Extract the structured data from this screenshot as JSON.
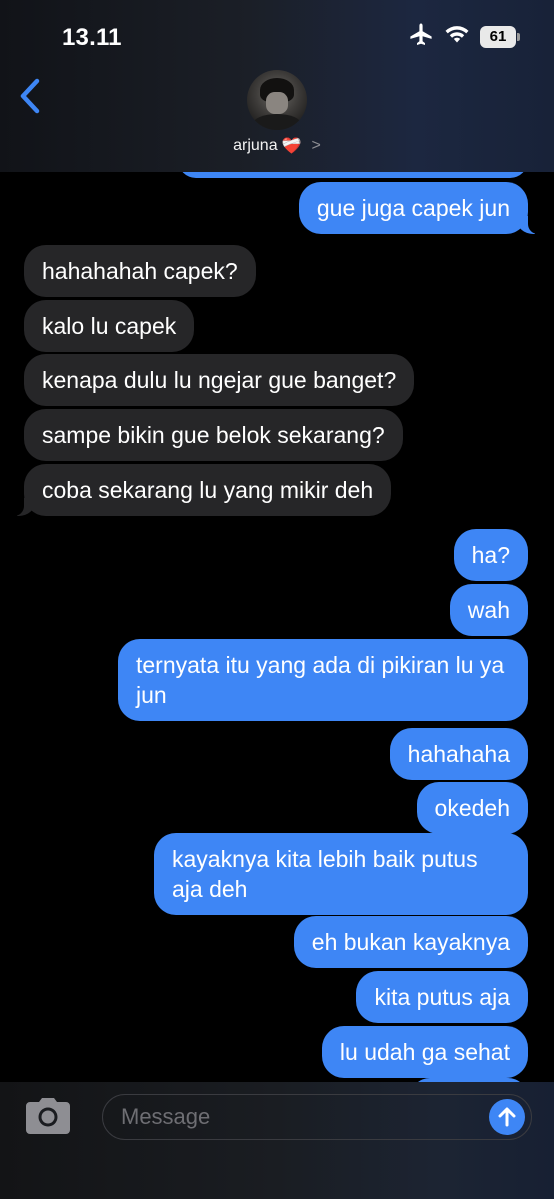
{
  "status_bar": {
    "time": "13.11",
    "battery": "61",
    "icons": [
      "airplane-icon",
      "wifi-icon",
      "battery-icon"
    ]
  },
  "header": {
    "contact_name": "arjuna",
    "contact_emoji": "❤️‍🩹",
    "chevron": ">"
  },
  "messages": [
    {
      "side": "sent",
      "text": "",
      "partial": true
    },
    {
      "side": "sent",
      "text": "gue juga capek jun"
    },
    {
      "side": "received",
      "text": "hahahahah capek?"
    },
    {
      "side": "received",
      "text": "kalo lu capek"
    },
    {
      "side": "received",
      "text": "kenapa dulu lu ngejar gue banget?"
    },
    {
      "side": "received",
      "text": "sampe bikin gue belok sekarang?"
    },
    {
      "side": "received",
      "text": "coba sekarang lu yang mikir deh"
    },
    {
      "side": "sent",
      "text": "ha?"
    },
    {
      "side": "sent",
      "text": "wah"
    },
    {
      "side": "sent",
      "text": "ternyata itu yang ada di pikiran lu ya jun"
    },
    {
      "side": "sent",
      "text": "hahahaha"
    },
    {
      "side": "sent",
      "text": "okedeh"
    },
    {
      "side": "sent",
      "text": "kayaknya kita lebih baik putus aja deh"
    },
    {
      "side": "sent",
      "text": "eh bukan kayaknya"
    },
    {
      "side": "sent",
      "text": "kita putus aja"
    },
    {
      "side": "sent",
      "text": "lu udah ga sehat"
    },
    {
      "side": "sent",
      "text": "",
      "partial": true
    }
  ],
  "composer": {
    "placeholder": "Message"
  },
  "colors": {
    "sent_bubble": "#3e86f5",
    "received_bubble": "#262628",
    "accent": "#3e86f5"
  }
}
